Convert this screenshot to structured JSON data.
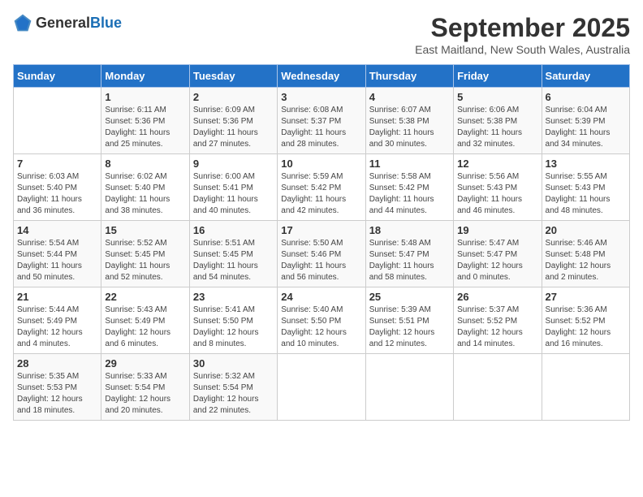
{
  "header": {
    "logo_general": "General",
    "logo_blue": "Blue",
    "title": "September 2025",
    "subtitle": "East Maitland, New South Wales, Australia"
  },
  "days_of_week": [
    "Sunday",
    "Monday",
    "Tuesday",
    "Wednesday",
    "Thursday",
    "Friday",
    "Saturday"
  ],
  "weeks": [
    [
      {
        "day": "",
        "info": ""
      },
      {
        "day": "1",
        "info": "Sunrise: 6:11 AM\nSunset: 5:36 PM\nDaylight: 11 hours\nand 25 minutes."
      },
      {
        "day": "2",
        "info": "Sunrise: 6:09 AM\nSunset: 5:36 PM\nDaylight: 11 hours\nand 27 minutes."
      },
      {
        "day": "3",
        "info": "Sunrise: 6:08 AM\nSunset: 5:37 PM\nDaylight: 11 hours\nand 28 minutes."
      },
      {
        "day": "4",
        "info": "Sunrise: 6:07 AM\nSunset: 5:38 PM\nDaylight: 11 hours\nand 30 minutes."
      },
      {
        "day": "5",
        "info": "Sunrise: 6:06 AM\nSunset: 5:38 PM\nDaylight: 11 hours\nand 32 minutes."
      },
      {
        "day": "6",
        "info": "Sunrise: 6:04 AM\nSunset: 5:39 PM\nDaylight: 11 hours\nand 34 minutes."
      }
    ],
    [
      {
        "day": "7",
        "info": "Sunrise: 6:03 AM\nSunset: 5:40 PM\nDaylight: 11 hours\nand 36 minutes."
      },
      {
        "day": "8",
        "info": "Sunrise: 6:02 AM\nSunset: 5:40 PM\nDaylight: 11 hours\nand 38 minutes."
      },
      {
        "day": "9",
        "info": "Sunrise: 6:00 AM\nSunset: 5:41 PM\nDaylight: 11 hours\nand 40 minutes."
      },
      {
        "day": "10",
        "info": "Sunrise: 5:59 AM\nSunset: 5:42 PM\nDaylight: 11 hours\nand 42 minutes."
      },
      {
        "day": "11",
        "info": "Sunrise: 5:58 AM\nSunset: 5:42 PM\nDaylight: 11 hours\nand 44 minutes."
      },
      {
        "day": "12",
        "info": "Sunrise: 5:56 AM\nSunset: 5:43 PM\nDaylight: 11 hours\nand 46 minutes."
      },
      {
        "day": "13",
        "info": "Sunrise: 5:55 AM\nSunset: 5:43 PM\nDaylight: 11 hours\nand 48 minutes."
      }
    ],
    [
      {
        "day": "14",
        "info": "Sunrise: 5:54 AM\nSunset: 5:44 PM\nDaylight: 11 hours\nand 50 minutes."
      },
      {
        "day": "15",
        "info": "Sunrise: 5:52 AM\nSunset: 5:45 PM\nDaylight: 11 hours\nand 52 minutes."
      },
      {
        "day": "16",
        "info": "Sunrise: 5:51 AM\nSunset: 5:45 PM\nDaylight: 11 hours\nand 54 minutes."
      },
      {
        "day": "17",
        "info": "Sunrise: 5:50 AM\nSunset: 5:46 PM\nDaylight: 11 hours\nand 56 minutes."
      },
      {
        "day": "18",
        "info": "Sunrise: 5:48 AM\nSunset: 5:47 PM\nDaylight: 11 hours\nand 58 minutes."
      },
      {
        "day": "19",
        "info": "Sunrise: 5:47 AM\nSunset: 5:47 PM\nDaylight: 12 hours\nand 0 minutes."
      },
      {
        "day": "20",
        "info": "Sunrise: 5:46 AM\nSunset: 5:48 PM\nDaylight: 12 hours\nand 2 minutes."
      }
    ],
    [
      {
        "day": "21",
        "info": "Sunrise: 5:44 AM\nSunset: 5:49 PM\nDaylight: 12 hours\nand 4 minutes."
      },
      {
        "day": "22",
        "info": "Sunrise: 5:43 AM\nSunset: 5:49 PM\nDaylight: 12 hours\nand 6 minutes."
      },
      {
        "day": "23",
        "info": "Sunrise: 5:41 AM\nSunset: 5:50 PM\nDaylight: 12 hours\nand 8 minutes."
      },
      {
        "day": "24",
        "info": "Sunrise: 5:40 AM\nSunset: 5:50 PM\nDaylight: 12 hours\nand 10 minutes."
      },
      {
        "day": "25",
        "info": "Sunrise: 5:39 AM\nSunset: 5:51 PM\nDaylight: 12 hours\nand 12 minutes."
      },
      {
        "day": "26",
        "info": "Sunrise: 5:37 AM\nSunset: 5:52 PM\nDaylight: 12 hours\nand 14 minutes."
      },
      {
        "day": "27",
        "info": "Sunrise: 5:36 AM\nSunset: 5:52 PM\nDaylight: 12 hours\nand 16 minutes."
      }
    ],
    [
      {
        "day": "28",
        "info": "Sunrise: 5:35 AM\nSunset: 5:53 PM\nDaylight: 12 hours\nand 18 minutes."
      },
      {
        "day": "29",
        "info": "Sunrise: 5:33 AM\nSunset: 5:54 PM\nDaylight: 12 hours\nand 20 minutes."
      },
      {
        "day": "30",
        "info": "Sunrise: 5:32 AM\nSunset: 5:54 PM\nDaylight: 12 hours\nand 22 minutes."
      },
      {
        "day": "",
        "info": ""
      },
      {
        "day": "",
        "info": ""
      },
      {
        "day": "",
        "info": ""
      },
      {
        "day": "",
        "info": ""
      }
    ]
  ]
}
